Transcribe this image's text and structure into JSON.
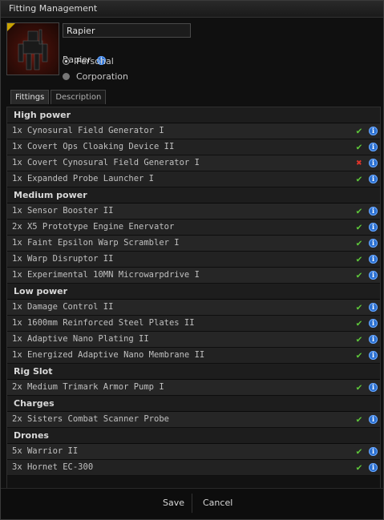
{
  "window": {
    "title": "Fitting Management"
  },
  "header": {
    "fitting_name": "Rapier",
    "ship_type": "Rapier",
    "owner_options": [
      {
        "label": "Personal",
        "selected": true
      },
      {
        "label": "Corporation",
        "selected": false
      }
    ]
  },
  "tabs": [
    {
      "label": "Fittings",
      "active": true
    },
    {
      "label": "Description",
      "active": false
    }
  ],
  "sections": [
    {
      "title": "High power",
      "items": [
        {
          "text": "1x Cynosural Field Generator I",
          "status": "ok"
        },
        {
          "text": "1x Covert Ops Cloaking Device II",
          "status": "ok"
        },
        {
          "text": "1x Covert Cynosural Field Generator I",
          "status": "missing"
        },
        {
          "text": "1x Expanded Probe Launcher I",
          "status": "ok"
        }
      ]
    },
    {
      "title": "Medium power",
      "items": [
        {
          "text": "1x Sensor Booster II",
          "status": "ok"
        },
        {
          "text": "2x X5 Prototype Engine Enervator",
          "status": "ok"
        },
        {
          "text": "1x Faint Epsilon Warp Scrambler I",
          "status": "ok"
        },
        {
          "text": "1x Warp Disruptor II",
          "status": "ok"
        },
        {
          "text": "1x Experimental 10MN Microwarpdrive I",
          "status": "ok"
        }
      ]
    },
    {
      "title": "Low power",
      "items": [
        {
          "text": "1x Damage Control II",
          "status": "ok"
        },
        {
          "text": "1x 1600mm Reinforced Steel Plates II",
          "status": "ok"
        },
        {
          "text": "1x Adaptive Nano Plating II",
          "status": "ok"
        },
        {
          "text": "1x Energized Adaptive Nano Membrane II",
          "status": "ok"
        }
      ]
    },
    {
      "title": "Rig Slot",
      "items": [
        {
          "text": "2x Medium Trimark Armor Pump I",
          "status": "ok"
        }
      ]
    },
    {
      "title": "Charges",
      "items": [
        {
          "text": "2x Sisters Combat Scanner Probe",
          "status": "ok"
        }
      ]
    },
    {
      "title": "Drones",
      "items": [
        {
          "text": "5x Warrior II",
          "status": "ok"
        },
        {
          "text": "3x Hornet EC-300",
          "status": "ok"
        }
      ]
    }
  ],
  "icons": {
    "ok": "✔",
    "missing": "✖",
    "info": "i"
  },
  "colors": {
    "ok": "#5ec83a",
    "missing": "#e0342a",
    "info": "#2a6fd0"
  },
  "footer": {
    "save_label": "Save",
    "cancel_label": "Cancel"
  }
}
